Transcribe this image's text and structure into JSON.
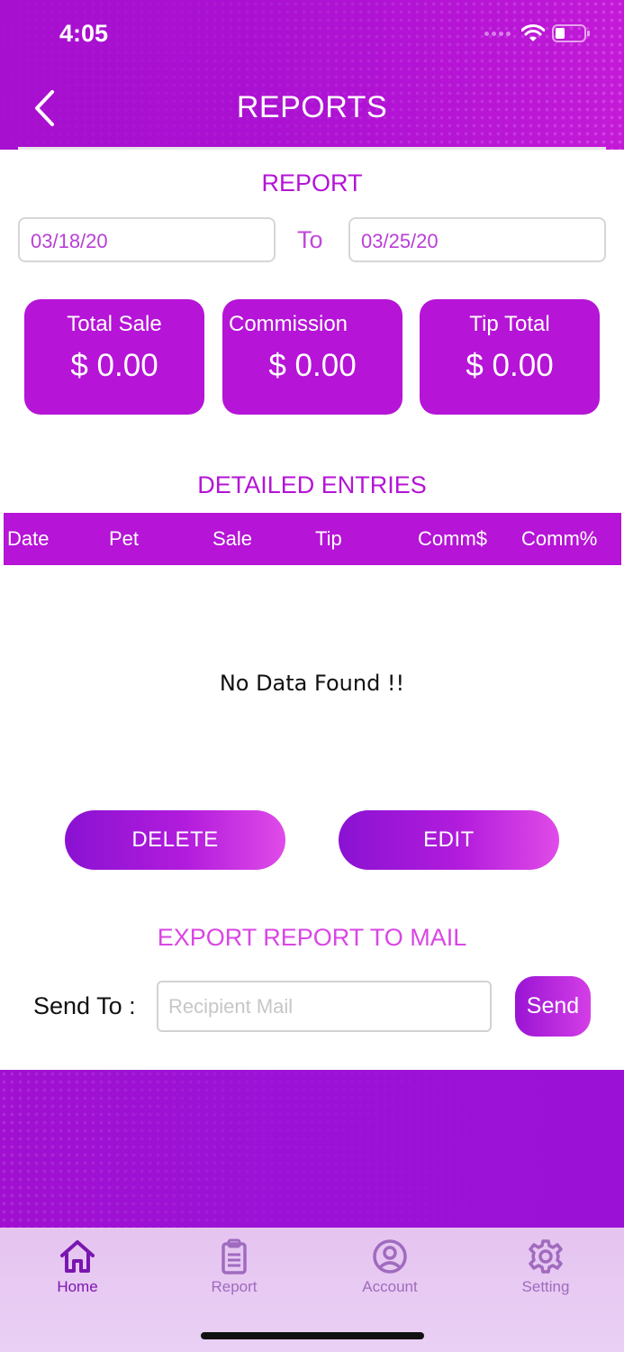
{
  "status_bar": {
    "time": "4:05"
  },
  "header": {
    "title": "REPORTS"
  },
  "report": {
    "section_label": "REPORT",
    "from_date": "03/18/20",
    "to_label": "To",
    "to_date": "03/25/20"
  },
  "stats": [
    {
      "label": "Total Sale",
      "value": "$ 0.00"
    },
    {
      "label": "Commission",
      "value": "$ 0.00"
    },
    {
      "label": "Tip Total",
      "value": "$ 0.00"
    }
  ],
  "entries": {
    "section_label": "DETAILED ENTRIES",
    "columns": [
      "Date",
      "Pet",
      "Sale",
      "Tip",
      "Comm$",
      "Comm%"
    ],
    "empty_message": "No Data Found !!"
  },
  "actions": {
    "delete_label": "DELETE",
    "edit_label": "EDIT"
  },
  "export": {
    "section_label": "EXPORT REPORT TO MAIL",
    "send_to_label": "Send To :",
    "mail_placeholder": "Recipient Mail",
    "mail_value": "",
    "send_label": "Send"
  },
  "tabs": [
    {
      "label": "Home",
      "icon": "home-icon",
      "active": true
    },
    {
      "label": "Report",
      "icon": "clipboard-icon",
      "active": false
    },
    {
      "label": "Account",
      "icon": "user-circle-icon",
      "active": false
    },
    {
      "label": "Setting",
      "icon": "gear-icon",
      "active": false
    }
  ],
  "colors": {
    "brand_purple": "#b614d7",
    "tab_active": "#7a16b0",
    "tab_inactive": "#a06bbf"
  }
}
